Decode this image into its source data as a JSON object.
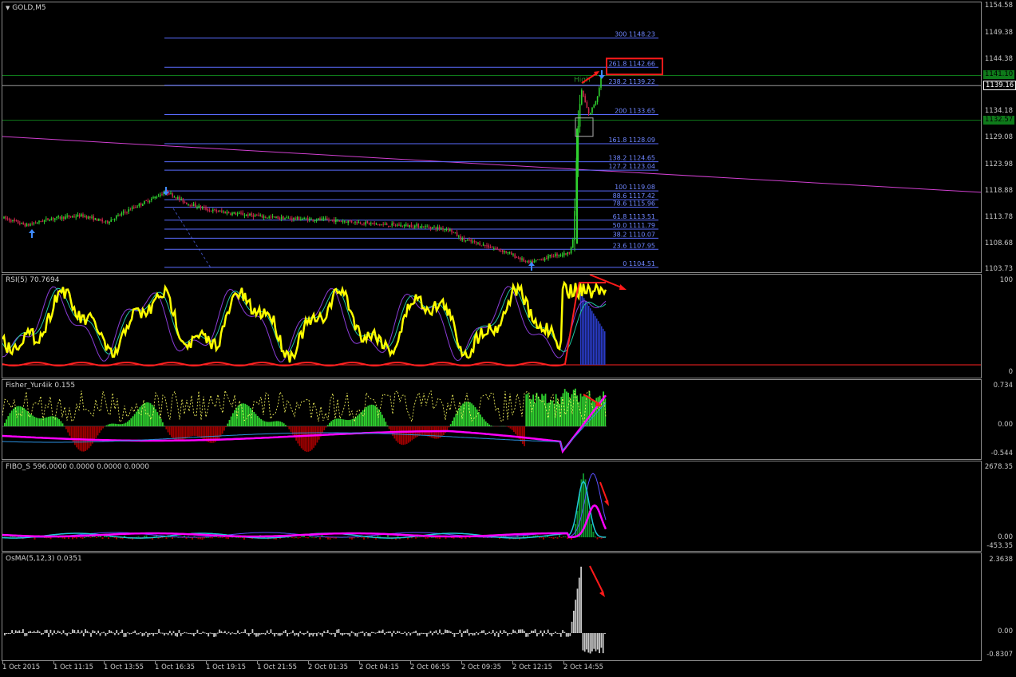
{
  "main": {
    "symbol_label": "GOLD,M5",
    "marker_high": "High",
    "price_ticks": [
      "1154.58",
      "1149.38",
      "1144.38",
      "1139.16",
      "1134.18",
      "1129.08",
      "1123.98",
      "1118.88",
      "1113.78",
      "1108.68",
      "1103.73"
    ],
    "tag_ask": "1141.10",
    "tag_bid": "1139.16",
    "tag_green": "1132.57",
    "fib_levels": [
      {
        "pct": "300",
        "price": "1148.23"
      },
      {
        "pct": "261.8",
        "price": "1142.66"
      },
      {
        "pct": "238.2",
        "price": "1139.22"
      },
      {
        "pct": "200",
        "price": "1133.65"
      },
      {
        "pct": "161.8",
        "price": "1128.09"
      },
      {
        "pct": "138.2",
        "price": "1124.65"
      },
      {
        "pct": "127.2",
        "price": "1123.04"
      },
      {
        "pct": "100",
        "price": "1119.08"
      },
      {
        "pct": "88.6",
        "price": "1117.42"
      },
      {
        "pct": "78.6",
        "price": "1115.96"
      },
      {
        "pct": "61.8",
        "price": "1113.51"
      },
      {
        "pct": "50.0",
        "price": "1111.79"
      },
      {
        "pct": "38.2",
        "price": "1110.07"
      },
      {
        "pct": "23.6",
        "price": "1107.95"
      },
      {
        "pct": "0",
        "price": "1104.51"
      }
    ]
  },
  "rsi": {
    "label": "RSI(5) 70.7694",
    "ticks": [
      "100",
      "0"
    ]
  },
  "fisher": {
    "label": "Fisher_Yur4ik 0.155",
    "ticks": [
      "0.734",
      "0.00",
      "-0.544"
    ]
  },
  "fibo_s": {
    "label": "FIBO_S 596.0000 0.0000 0.0000 0.0000",
    "ticks": [
      "2678.35",
      "0.00",
      "-453.35"
    ]
  },
  "osma": {
    "label": "OsMA(5,12,3) 0.0351",
    "ticks": [
      "2.3638",
      "0.00",
      "-0.8307"
    ]
  },
  "time_labels": [
    "1 Oct 2015",
    "1 Oct 11:15",
    "1 Oct 13:55",
    "1 Oct 16:35",
    "1 Oct 19:15",
    "1 Oct 21:55",
    "2 Oct 01:35",
    "2 Oct 04:15",
    "2 Oct 06:55",
    "2 Oct 09:35",
    "2 Oct 12:15",
    "2 Oct 14:55"
  ],
  "colors": {
    "fib": "#5a6cff",
    "bull": "#2fd12f",
    "bear": "#c8244a",
    "trend": "#d040d0",
    "rsi_main": "#ffff00",
    "rsi_signal": "#ff2020",
    "hist_green": "#2fd12f",
    "hist_red": "#a00000",
    "magenta": "#ff00ff",
    "cyan": "#20c8d8",
    "gray": "#c8c8c8",
    "annotation": "#ff1a1a"
  }
}
